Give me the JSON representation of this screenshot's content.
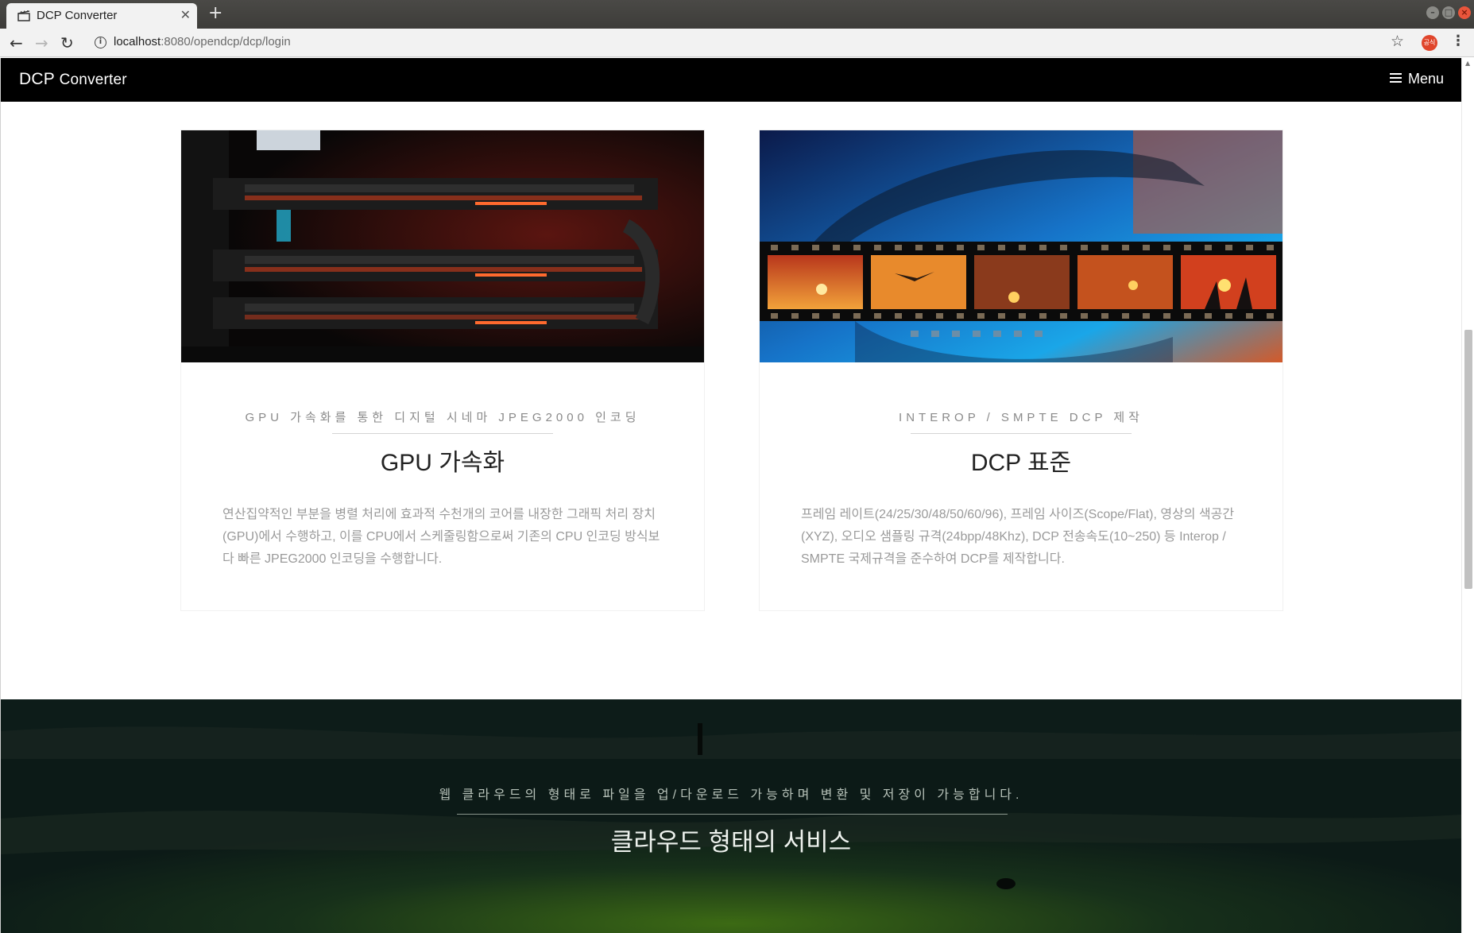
{
  "browser": {
    "tab_title": "DCP Converter",
    "new_tab_symbol": "+",
    "url_host": "localhost",
    "url_rest": ":8080/opendcp/dcp/login",
    "profile_label": "공식"
  },
  "nav": {
    "brand_main": "DCP",
    "brand_sub": "Converter",
    "menu_label": "Menu"
  },
  "features": [
    {
      "subtitle": "GPU 가속화를 통한 디지털 시네마 JPEG2000 인코딩",
      "title": "GPU 가속화",
      "body": "연산집약적인 부분을 병렬 처리에 효과적 수천개의 코어를 내장한 그래픽 처리 장치(GPU)에서 수행하고, 이를 CPU에서 스케줄링함으로써 기존의 CPU 인코딩 방식보다 빠른 JPEG2000 인코딩을 수행합니다.",
      "image": "gpu-graphics-cards-image"
    },
    {
      "subtitle": "INTEROP / SMPTE DCP 제작",
      "title": "DCP 표준",
      "body": "프레임 레이트(24/25/30/48/50/60/96), 프레임 사이즈(Scope/Flat), 영상의 색공간(XYZ), 오디오 샘플링 규격(24bpp/48Khz), DCP 전송속도(10~250) 등 Interop / SMPTE 국제규격을 준수하여 DCP를 제작합니다.",
      "image": "film-strip-sunset-image"
    }
  ],
  "cloud": {
    "subtitle": "웹 클라우드의 형태로 파일을 업/다운로드 가능하며 변환 및 저장이 가능합니다.",
    "title": "클라우드 형태의 서비스"
  }
}
